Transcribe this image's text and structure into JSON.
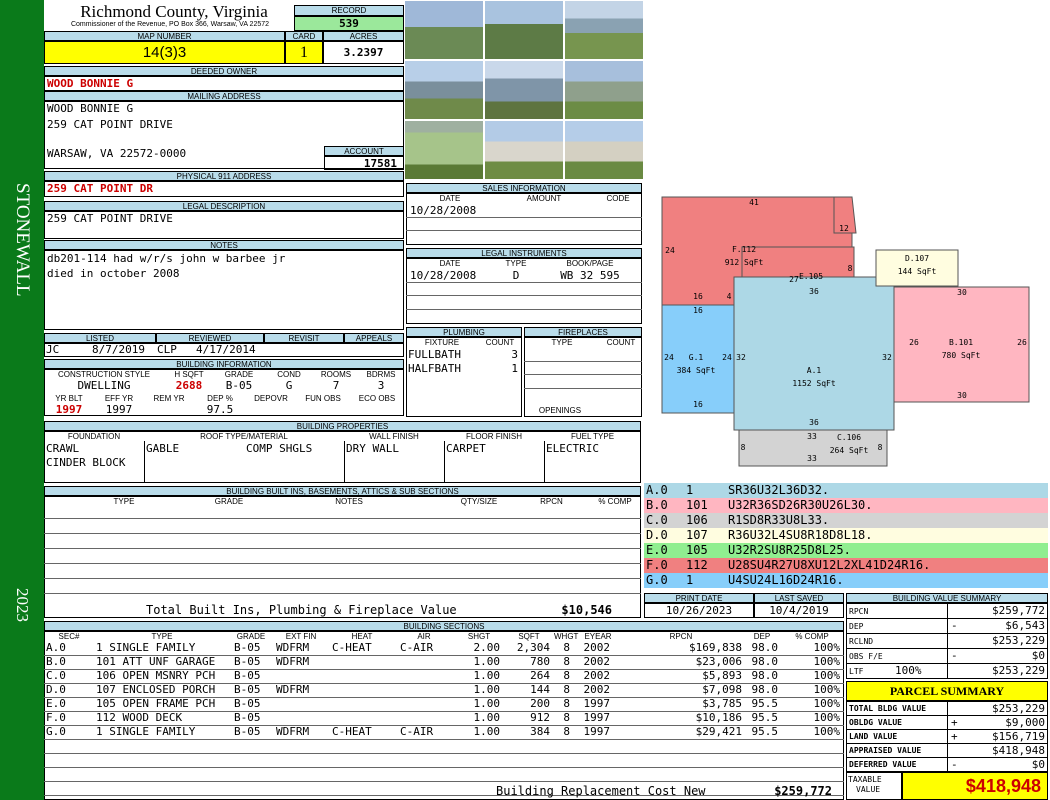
{
  "county": {
    "title": "Richmond County, Virginia",
    "subtitle": "Commissioner of the Revenue, PO Box 366, Warsaw, VA 22572",
    "district": "STONEWALL",
    "year": "2023"
  },
  "record": {
    "label": "RECORD",
    "value": "539"
  },
  "map": {
    "label": "MAP NUMBER",
    "value": "14(3)3",
    "card_label": "CARD",
    "card": "1",
    "acres_label": "ACRES",
    "acres": "3.2397"
  },
  "owner": {
    "label": "DEEDED OWNER",
    "name": "WOOD BONNIE G",
    "mail_label": "MAILING ADDRESS",
    "mail1": "WOOD BONNIE G",
    "mail2": "259 CAT POINT DRIVE",
    "mail3": "WARSAW, VA 22572-0000",
    "account_label": "ACCOUNT",
    "account": "17581"
  },
  "address": {
    "label": "PHYSICAL 911 ADDRESS",
    "value": "259 CAT POINT DR"
  },
  "legal": {
    "label": "LEGAL DESCRIPTION",
    "value": "259 CAT POINT DRIVE"
  },
  "notes": {
    "label": "NOTES",
    "line1": "db201-114 had w/r/s john w barbee jr",
    "line2": "died in october 2008"
  },
  "review": {
    "h_listed": "LISTED",
    "h_reviewed": "REVIEWED",
    "h_revisit": "REVISIT",
    "h_appeals": "APPEALS",
    "listed_by": "JC",
    "listed_date": "8/7/2019",
    "rev_by": "CLP",
    "rev_date": "4/17/2014"
  },
  "building": {
    "label": "BUILDING INFORMATION",
    "h_style": "CONSTRUCTION STYLE",
    "h_hsqft": "H SQFT",
    "h_grade": "GRADE",
    "h_cond": "COND",
    "h_rooms": "ROOMS",
    "h_bdrms": "BDRMS",
    "style": "DWELLING",
    "hsqft": "2688",
    "grade": "B-05",
    "cond": "G",
    "rooms": "7",
    "bdrms": "3",
    "h_yrblt": "YR BLT",
    "h_effyr": "EFF YR",
    "h_remyr": "REM YR",
    "h_dep": "DEP %",
    "h_depovr": "DEPOVR",
    "h_funobs": "FUN OBS",
    "h_ecoobs": "ECO OBS",
    "yrblt": "1997",
    "effyr": "1997",
    "dep": "97.5"
  },
  "props": {
    "label": "BUILDING PROPERTIES",
    "h_found": "FOUNDATION",
    "h_roof": "ROOF TYPE/MATERIAL",
    "h_wall": "WALL FINISH",
    "h_floor": "FLOOR FINISH",
    "h_fuel": "FUEL TYPE",
    "found1": "CRAWL",
    "found2": "CINDER BLOCK",
    "roof1": "GABLE",
    "roof2": "COMP SHGLS",
    "wall": "DRY WALL",
    "floor": "CARPET",
    "fuel": "ELECTRIC"
  },
  "builtins": {
    "label": "BUILDING BUILT INS, BASEMENTS, ATTICS & SUB SECTIONS",
    "h_type": "TYPE",
    "h_grade": "GRADE",
    "h_notes": "NOTES",
    "h_qty": "QTY/SIZE",
    "h_rpcn": "RPCN",
    "h_comp": "% COMP",
    "total_label": "Total Built Ins, Plumbing & Fireplace Value",
    "total": "$10,546"
  },
  "sales": {
    "label": "SALES INFORMATION",
    "h_date": "DATE",
    "h_amount": "AMOUNT",
    "h_code": "CODE",
    "date": "10/28/2008"
  },
  "instruments": {
    "label": "LEGAL INSTRUMENTS",
    "h_date": "DATE",
    "h_type": "TYPE",
    "h_book": "BOOK/PAGE",
    "date": "10/28/2008",
    "type": "D",
    "book": "WB 32 595"
  },
  "plumbing": {
    "label": "PLUMBING",
    "h_fixture": "FIXTURE",
    "h_count": "COUNT",
    "r1": "FULLBATH",
    "c1": "3",
    "r2": "HALFBATH",
    "c2": "1"
  },
  "fireplaces": {
    "label": "FIREPLACES",
    "h_type": "TYPE",
    "h_count": "COUNT",
    "openings": "OPENINGS"
  },
  "sketch": {
    "sections": [
      {
        "label": "F.112",
        "area": "912 SqFt"
      },
      {
        "label": "E.105",
        "area": ""
      },
      {
        "label": "D.107",
        "area": "144 SqFt"
      },
      {
        "label": "G.1",
        "area": "384 SqFt"
      },
      {
        "label": "A.1",
        "area": "1152 SqFt"
      },
      {
        "label": "B.101",
        "area": "780 SqFt"
      },
      {
        "label": "C.106",
        "area": "264 SqFt"
      }
    ],
    "dims": [
      "41",
      "12",
      "24",
      "8",
      "27",
      "16",
      "4",
      "36",
      "16",
      "24",
      "24",
      "32",
      "32",
      "16",
      "36",
      "30",
      "26",
      "26",
      "30",
      "33",
      "8",
      "8",
      "33"
    ]
  },
  "legend": [
    {
      "sec": "A.0",
      "code": "1",
      "desc": "SR36U32L36D32.",
      "color": "#add8e6"
    },
    {
      "sec": "B.0",
      "code": "101",
      "desc": "U32R36SD26R30U26L30.",
      "color": "#ffb6c1"
    },
    {
      "sec": "C.0",
      "code": "106",
      "desc": "R1SD8R33U8L33.",
      "color": "#d3d3d3"
    },
    {
      "sec": "D.0",
      "code": "107",
      "desc": "R36U32L4SU8R18D8L18.",
      "color": "#fffde0"
    },
    {
      "sec": "E.0",
      "code": "105",
      "desc": "U32R2SU8R25D8L25.",
      "color": "#90ee90"
    },
    {
      "sec": "F.0",
      "code": "112",
      "desc": "U28SU4R27U8XU12L2XL41D24R16.",
      "color": "#f08080"
    },
    {
      "sec": "G.0",
      "code": "1",
      "desc": "U4SU24L16D24R16.",
      "color": "#87cefa"
    }
  ],
  "dates": {
    "h_print": "PRINT DATE",
    "h_saved": "LAST SAVED",
    "print": "10/26/2023",
    "saved": "10/4/2019"
  },
  "sections": {
    "label": "BUILDING SECTIONS",
    "headers": [
      "SEC#",
      "TYPE",
      "GRADE",
      "EXT FIN",
      "HEAT",
      "AIR",
      "SHGT",
      "SQFT",
      "WHGT",
      "EYEAR",
      "RPCN",
      "DEP",
      "% COMP"
    ],
    "rows": [
      [
        "A.0",
        "1 SINGLE FAMILY",
        "B-05",
        "WDFRM",
        "C-HEAT",
        "C-AIR",
        "2.00",
        "2,304",
        "8",
        "2002",
        "$169,838",
        "98.0",
        "100%"
      ],
      [
        "B.0",
        "101 ATT UNF GARAGE",
        "B-05",
        "WDFRM",
        "",
        "",
        "1.00",
        "780",
        "8",
        "2002",
        "$23,006",
        "98.0",
        "100%"
      ],
      [
        "C.0",
        "106 OPEN MSNRY PCH",
        "B-05",
        "",
        "",
        "",
        "1.00",
        "264",
        "8",
        "2002",
        "$5,893",
        "98.0",
        "100%"
      ],
      [
        "D.0",
        "107 ENCLOSED PORCH",
        "B-05",
        "WDFRM",
        "",
        "",
        "1.00",
        "144",
        "8",
        "2002",
        "$7,098",
        "98.0",
        "100%"
      ],
      [
        "E.0",
        "105 OPEN FRAME PCH",
        "B-05",
        "",
        "",
        "",
        "1.00",
        "200",
        "8",
        "1997",
        "$3,785",
        "95.5",
        "100%"
      ],
      [
        "F.0",
        "112 WOOD DECK",
        "B-05",
        "",
        "",
        "",
        "1.00",
        "912",
        "8",
        "1997",
        "$10,186",
        "95.5",
        "100%"
      ],
      [
        "G.0",
        "1 SINGLE FAMILY",
        "B-05",
        "WDFRM",
        "C-HEAT",
        "C-AIR",
        "1.00",
        "384",
        "8",
        "1997",
        "$29,421",
        "95.5",
        "100%"
      ]
    ],
    "total_label": "Building Replacement Cost New",
    "total": "$259,772"
  },
  "summary": {
    "label": "BUILDING VALUE SUMMARY",
    "rows": [
      {
        "k": "RPCN",
        "s": "",
        "v": "$259,772"
      },
      {
        "k": "DEP",
        "s": "-",
        "v": "$6,543"
      },
      {
        "k": "RCLND",
        "s": "",
        "v": "$253,229"
      },
      {
        "k": "OBS F/E",
        "s": "-",
        "v": "$0"
      },
      {
        "k": "LTF",
        "s": "100%",
        "v": "$253,229"
      }
    ]
  },
  "parcel": {
    "label": "PARCEL SUMMARY",
    "rows": [
      {
        "k": "TOTAL BLDG VALUE",
        "s": "",
        "v": "$253,229"
      },
      {
        "k": "OBLDG VALUE",
        "s": "+",
        "v": "$9,000"
      },
      {
        "k": "LAND VALUE",
        "s": "+",
        "v": "$156,719"
      },
      {
        "k": "APPRAISED VALUE",
        "s": "",
        "v": "$418,948"
      },
      {
        "k": "DEFERRED VALUE",
        "s": "-",
        "v": "$0"
      }
    ],
    "taxable_label1": "TAXABLE",
    "taxable_label2": "VALUE",
    "taxable": "$418,948"
  }
}
